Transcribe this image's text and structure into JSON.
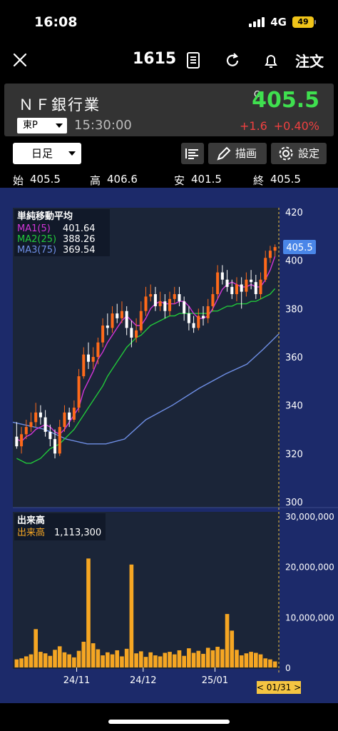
{
  "status": {
    "time": "16:08",
    "network": "4G",
    "battery": "49"
  },
  "nav": {
    "code": "1615",
    "order_label": "注文"
  },
  "quote": {
    "name": "ＮＦ銀行業",
    "price_flag": "C",
    "price": "405.5",
    "market": "東P",
    "time": "15:30:00",
    "change": "+1.6",
    "change_pct": "+0.40%"
  },
  "toolbar": {
    "period": "日足",
    "draw_label": "描画",
    "settings_label": "設定"
  },
  "ohlc": {
    "open_label": "始",
    "open": "405.5",
    "high_label": "高",
    "high": "406.6",
    "low_label": "安",
    "low": "401.5",
    "close_label": "終",
    "close": "405.5"
  },
  "colors": {
    "up": "#ff6a1a",
    "down": "#ffffff",
    "ma1": "#d235d8",
    "ma2": "#22c83a",
    "ma3": "#6f8fe6",
    "volume": "#f5a623",
    "price_tag": "#4a86e8"
  },
  "legend": {
    "title": "単純移動平均",
    "items": [
      {
        "label": "MA1(5)",
        "value": "401.64",
        "color": "#d235d8"
      },
      {
        "label": "MA2(25)",
        "value": "388.26",
        "color": "#22c83a"
      },
      {
        "label": "MA3(75)",
        "value": "369.54",
        "color": "#6f8fe6"
      }
    ]
  },
  "volume_legend": {
    "title": "出来高",
    "label": "出来高",
    "value": "1,113,300"
  },
  "price_tag": "405.5",
  "cursor_date": "< 01/31 >",
  "chart_data": {
    "type": "candlestick",
    "price_axis": {
      "ylim": [
        300,
        420
      ],
      "ticks": [
        "420",
        "400",
        "380",
        "360",
        "340",
        "320",
        "300"
      ]
    },
    "volume_axis": {
      "ylim": [
        0,
        30000000
      ],
      "ticks": [
        "30,000,000",
        "20,000,000",
        "10,000,000",
        "0"
      ]
    },
    "x_labels": [
      "24/11",
      "24/12",
      "25/01"
    ],
    "candles": [
      [
        327,
        323,
        333,
        322
      ],
      [
        323,
        328,
        331,
        320
      ],
      [
        328,
        331,
        334,
        326
      ],
      [
        331,
        333,
        337,
        329
      ],
      [
        333,
        337,
        341,
        331
      ],
      [
        337,
        335,
        340,
        332
      ],
      [
        335,
        329,
        338,
        327
      ],
      [
        329,
        326,
        332,
        323
      ],
      [
        326,
        320,
        330,
        318
      ],
      [
        320,
        331,
        334,
        319
      ],
      [
        331,
        337,
        340,
        329
      ],
      [
        337,
        334,
        339,
        331
      ],
      [
        334,
        339,
        342,
        333
      ],
      [
        339,
        352,
        355,
        337
      ],
      [
        352,
        361,
        364,
        351
      ],
      [
        361,
        358,
        366,
        355
      ],
      [
        358,
        360,
        364,
        355
      ],
      [
        360,
        366,
        368,
        357
      ],
      [
        366,
        373,
        376,
        364
      ],
      [
        373,
        372,
        378,
        369
      ],
      [
        372,
        378,
        381,
        370
      ],
      [
        378,
        376,
        382,
        374
      ],
      [
        376,
        379,
        383,
        374
      ],
      [
        379,
        372,
        381,
        369
      ],
      [
        372,
        368,
        375,
        364
      ],
      [
        368,
        371,
        376,
        366
      ],
      [
        371,
        379,
        383,
        370
      ],
      [
        379,
        385,
        389,
        377
      ],
      [
        385,
        386,
        390,
        383
      ],
      [
        386,
        381,
        389,
        379
      ],
      [
        381,
        383,
        387,
        379
      ],
      [
        383,
        379,
        386,
        376
      ],
      [
        379,
        384,
        387,
        377
      ],
      [
        384,
        386,
        389,
        382
      ],
      [
        386,
        383,
        389,
        381
      ],
      [
        383,
        378,
        385,
        375
      ],
      [
        378,
        374,
        381,
        371
      ],
      [
        374,
        372,
        377,
        370
      ],
      [
        372,
        377,
        380,
        371
      ],
      [
        377,
        376,
        381,
        373
      ],
      [
        376,
        381,
        384,
        374
      ],
      [
        381,
        386,
        389,
        379
      ],
      [
        386,
        395,
        398,
        384
      ],
      [
        395,
        392,
        398,
        390
      ],
      [
        392,
        389,
        396,
        387
      ],
      [
        389,
        386,
        392,
        384
      ],
      [
        386,
        390,
        393,
        383
      ],
      [
        390,
        387,
        393,
        380
      ],
      [
        387,
        392,
        395,
        385
      ],
      [
        392,
        391,
        396,
        388
      ],
      [
        391,
        386,
        394,
        384
      ],
      [
        386,
        392,
        395,
        384
      ],
      [
        392,
        401,
        404,
        391
      ],
      [
        401,
        404,
        406,
        399
      ],
      [
        404,
        405.5,
        406.6,
        401.5
      ]
    ],
    "volume": [
      1.6,
      1.8,
      2.2,
      2.6,
      7.6,
      3.1,
      2.8,
      2.3,
      3.5,
      4.2,
      3.0,
      2.6,
      2.0,
      3.3,
      5.1,
      21.6,
      4.8,
      3.6,
      2.4,
      3.0,
      2.6,
      3.4,
      2.2,
      3.7,
      20.4,
      2.8,
      3.2,
      2.1,
      3.0,
      2.4,
      2.2,
      2.9,
      3.1,
      2.6,
      3.4,
      2.3,
      3.8,
      2.9,
      3.3,
      2.7,
      3.9,
      3.4,
      4.1,
      3.6,
      10.6,
      7.3,
      3.5,
      2.4,
      2.8,
      3.1,
      2.9,
      2.6,
      1.8,
      1.6,
      1.2
    ],
    "ma5": [
      326,
      325,
      327,
      328,
      330,
      331,
      332,
      331,
      329,
      328,
      330,
      333,
      336,
      339,
      346,
      350,
      354,
      359,
      362,
      366,
      369,
      372,
      375,
      377,
      375,
      373,
      373,
      376,
      380,
      382,
      383,
      382,
      382,
      382,
      383,
      383,
      381,
      378,
      376,
      376,
      377,
      380,
      384,
      388,
      390,
      391,
      390,
      389,
      389,
      390,
      389,
      389,
      392,
      396,
      401.64
    ],
    "ma25": [
      318,
      317,
      316,
      316,
      317,
      318,
      320,
      322,
      323,
      324,
      326,
      328,
      330,
      333,
      336,
      339,
      342,
      345,
      348,
      352,
      355,
      358,
      361,
      364,
      366,
      368,
      369,
      371,
      373,
      374,
      375,
      376,
      377,
      377,
      378,
      378,
      378,
      378,
      378,
      378,
      378,
      379,
      379,
      380,
      381,
      381,
      382,
      382,
      382,
      383,
      383,
      384,
      385,
      386,
      388.26
    ],
    "ma3_points": [
      [
        0,
        333
      ],
      [
        0.12,
        330
      ],
      [
        0.2,
        326
      ],
      [
        0.28,
        324
      ],
      [
        0.35,
        324
      ],
      [
        0.42,
        326
      ],
      [
        0.5,
        334
      ],
      [
        0.6,
        340
      ],
      [
        0.7,
        347
      ],
      [
        0.8,
        353
      ],
      [
        0.88,
        357
      ],
      [
        0.94,
        363
      ],
      [
        1.0,
        369.54
      ]
    ]
  }
}
